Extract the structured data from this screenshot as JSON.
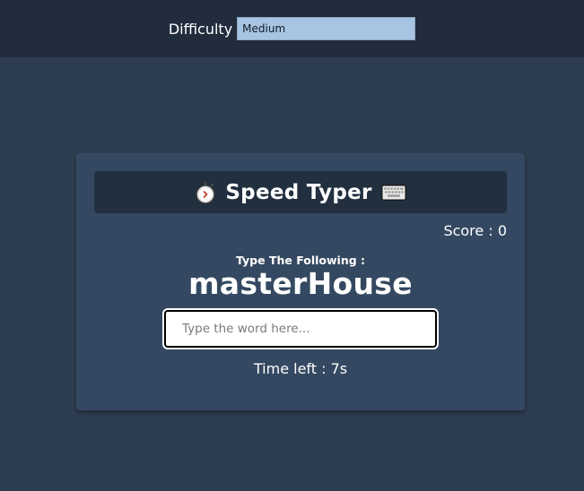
{
  "header": {
    "difficulty_label": "Difficulty",
    "difficulty_selected": "Medium"
  },
  "game": {
    "title": "Speed Typer",
    "title_icon_left": "stopwatch-icon",
    "title_icon_right": "keyboard-icon",
    "score_text": "Score : 0",
    "prompt_label": "Type The Following :",
    "word": "masterHouse",
    "input_placeholder": "Type the word here...",
    "input_value": "",
    "time_left_text": "Time left : 7s"
  },
  "colors": {
    "page_background": "#2e3e51",
    "topbar_background": "#212d3d",
    "card_background": "#344961",
    "title_bar_background": "#212f3f",
    "select_background": "#a7c4e2"
  }
}
